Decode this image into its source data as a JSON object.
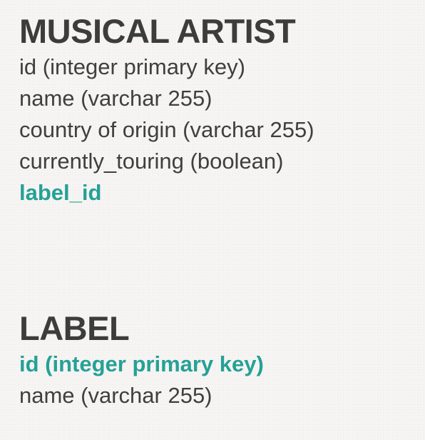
{
  "entities": [
    {
      "name": "MUSICAL ARTIST",
      "fields": [
        {
          "text": "id (integer primary key)",
          "highlight": false
        },
        {
          "text": "name (varchar 255)",
          "highlight": false
        },
        {
          "text": "country of origin (varchar 255)",
          "highlight": false
        },
        {
          "text": "currently_touring (boolean)",
          "highlight": false
        },
        {
          "text": "label_id",
          "highlight": true
        }
      ]
    },
    {
      "name": "LABEL",
      "fields": [
        {
          "text": "id (integer primary key)",
          "highlight": true
        },
        {
          "text": "name (varchar 255)",
          "highlight": false
        }
      ]
    }
  ],
  "colors": {
    "text": "#3f3f3f",
    "highlight": "#25a196",
    "background": "#f6f5f3"
  }
}
